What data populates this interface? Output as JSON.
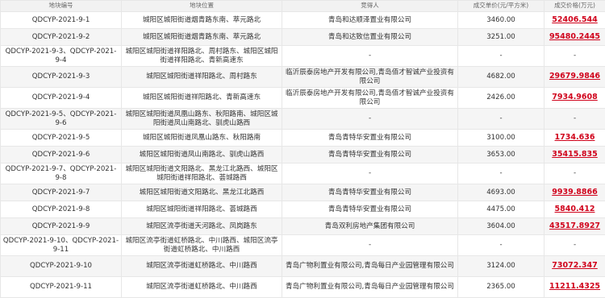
{
  "table": {
    "headers": [
      "地块编号",
      "地块位置",
      "竞得人",
      "成交单价(元/平方米)",
      "成交价格(万元)"
    ],
    "rows": [
      {
        "id": "QDCYP-2021-9-1",
        "location": "城阳区城阳街道烟青路东南、萃元路北",
        "winner": "青岛和达顺泽置业有限公司",
        "unit_price": "3460.00",
        "price": "52406.544"
      },
      {
        "id": "QDCYP-2021-9-2",
        "location": "城阳区城阳街道烟青路东南、萃元路北",
        "winner": "青岛和达致信置业有限公司",
        "unit_price": "3251.00",
        "price": "95480.2445"
      },
      {
        "id": "QDCYP-2021-9-3、QDCYP-2021-9-4",
        "location": "城阳区城阳街道祥阳路北、周村路东、城阳区城阳街道祥阳路北、青新高速东",
        "winner": "-",
        "unit_price": "-",
        "price": "-"
      },
      {
        "id": "QDCYP-2021-9-3",
        "location": "城阳区城阳街道祥阳路北、周村路东",
        "winner": "临沂辰泰房地产开发有限公司,青岛佰才智诚产业投资有限公司",
        "unit_price": "4682.00",
        "price": "29679.9846"
      },
      {
        "id": "QDCYP-2021-9-4",
        "location": "城阳区城阳街道祥阳路北、青新高速东",
        "winner": "临沂辰泰房地产开发有限公司,青岛佰才智诚产业投资有限公司",
        "unit_price": "2426.00",
        "price": "7934.9608"
      },
      {
        "id": "QDCYP-2021-9-5、QDCYP-2021-9-6",
        "location": "城阳区城阳街道凤凰山路东、秋阳路南、城阳区城阳街道凤山南路北、驯虎山路西",
        "winner": "-",
        "unit_price": "-",
        "price": "-"
      },
      {
        "id": "QDCYP-2021-9-5",
        "location": "城阳区城阳街道凤凰山路东、秋阳路南",
        "winner": "青岛青特华安置业有限公司",
        "unit_price": "3100.00",
        "price": "1734.636"
      },
      {
        "id": "QDCYP-2021-9-6",
        "location": "城阳区城阳街道凤山南路北、驯虎山路西",
        "winner": "青岛青特华安置业有限公司",
        "unit_price": "3653.00",
        "price": "35415.835"
      },
      {
        "id": "QDCYP-2021-9-7、QDCYP-2021-9-8",
        "location": "城阳区城阳街道文阳路北、黑龙江北路西、城阳区城阳街道祥阳路北、荟城路西",
        "winner": "-",
        "unit_price": "-",
        "price": "-"
      },
      {
        "id": "QDCYP-2021-9-7",
        "location": "城阳区城阳街道文阳路北、黑龙江北路西",
        "winner": "青岛青特华安置业有限公司",
        "unit_price": "4693.00",
        "price": "9939.8866"
      },
      {
        "id": "QDCYP-2021-9-8",
        "location": "城阳区城阳街道祥阳路北、荟城路西",
        "winner": "青岛青特华安置业有限公司",
        "unit_price": "4475.00",
        "price": "5840.412"
      },
      {
        "id": "QDCYP-2021-9-9",
        "location": "城阳区流亭街道天河路北、凤岗路东",
        "winner": "青岛双利房地产集团有限公司",
        "unit_price": "3604.00",
        "price": "43517.8927"
      },
      {
        "id": "QDCYP-2021-9-10、QDCYP-2021-9-11",
        "location": "城阳区流亭街道虹桥路北、中川路西、城阳区流亭街道虹桥路北、中川路西",
        "winner": "-",
        "unit_price": "-",
        "price": "-"
      },
      {
        "id": "QDCYP-2021-9-10",
        "location": "城阳区流亭街道虹桥路北、中川路西",
        "winner": "青岛广物利置业有限公司,青岛每日产业园管理有限公司",
        "unit_price": "3124.00",
        "price": "73072.347"
      },
      {
        "id": "QDCYP-2021-9-11",
        "location": "城阳区流亭街道虹桥路北、中川路西",
        "winner": "青岛广物利置业有限公司,青岛每日产业园管理有限公司",
        "unit_price": "2365.00",
        "price": "11211.4325"
      }
    ]
  }
}
